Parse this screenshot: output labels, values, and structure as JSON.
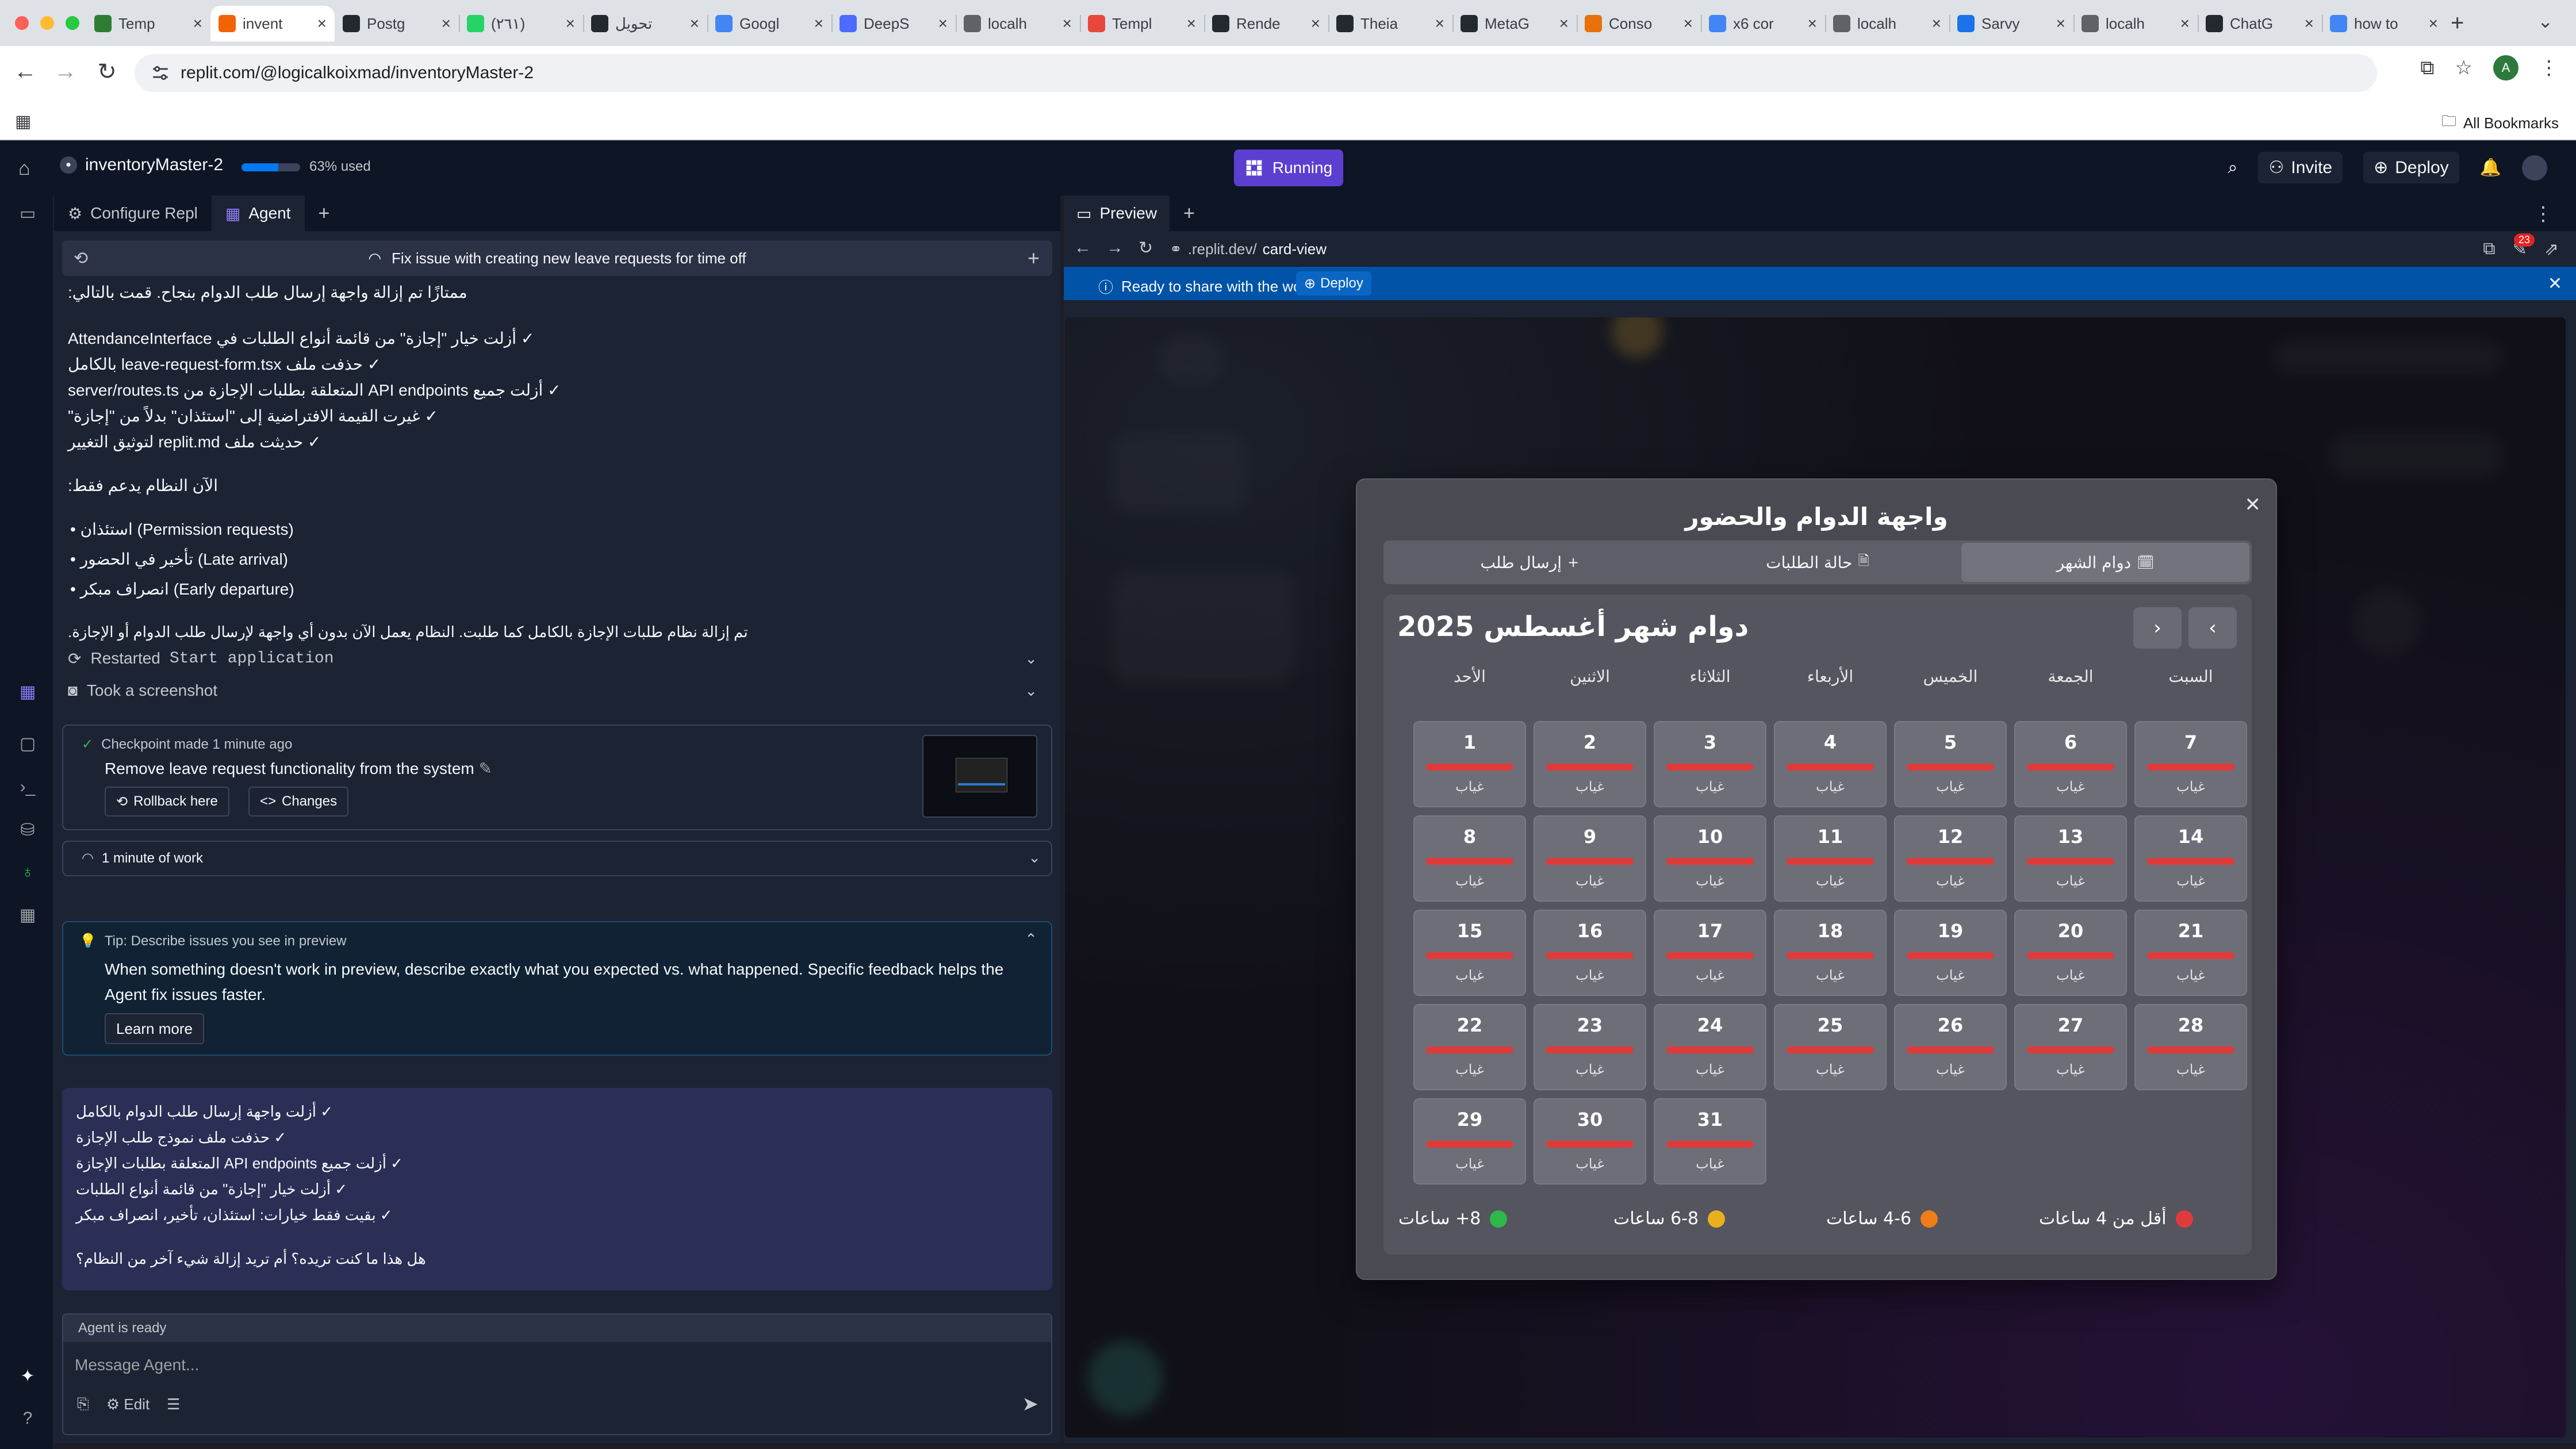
{
  "browser": {
    "tabs": [
      {
        "title": "Temp",
        "icon": "shield-icon",
        "color": "#2e7d32"
      },
      {
        "title": "invent",
        "icon": "replit-icon",
        "color": "#f26207",
        "active": true
      },
      {
        "title": "Postg",
        "icon": "github-icon",
        "color": "#24292f"
      },
      {
        "title": "(٢٦١)",
        "icon": "whatsapp-icon",
        "color": "#25d366"
      },
      {
        "title": "تحويل",
        "icon": "github-icon",
        "color": "#24292f"
      },
      {
        "title": "Googl",
        "icon": "gemini-icon",
        "color": "#4285f4"
      },
      {
        "title": "DeepS",
        "icon": "deepseek-icon",
        "color": "#4d6bfe"
      },
      {
        "title": "localh",
        "icon": "globe-icon",
        "color": "#5f6368"
      },
      {
        "title": "Templ",
        "icon": "bolt-icon",
        "color": "#e8483b"
      },
      {
        "title": "Rende",
        "icon": "render-icon",
        "color": "#24292f"
      },
      {
        "title": "Theia",
        "icon": "theia-icon",
        "color": "#24292f"
      },
      {
        "title": "MetaG",
        "icon": "github-icon",
        "color": "#24292f"
      },
      {
        "title": "Conso",
        "icon": "ring-icon",
        "color": "#e8710a"
      },
      {
        "title": "x6 cor",
        "icon": "google-icon",
        "color": "#4285f4"
      },
      {
        "title": "localh",
        "icon": "globe-icon",
        "color": "#5f6368"
      },
      {
        "title": "Sarvy",
        "icon": "doc-icon",
        "color": "#1a73e8"
      },
      {
        "title": "localh",
        "icon": "globe-icon",
        "color": "#5f6368"
      },
      {
        "title": "ChatG",
        "icon": "chatgpt-icon",
        "color": "#24292f"
      },
      {
        "title": "how to",
        "icon": "google-icon",
        "color": "#4285f4"
      }
    ],
    "url": "replit.com/@logicalkoixmad/inventoryMaster-2",
    "bookmarks_label": "All Bookmarks",
    "profile_initial": "A"
  },
  "replit": {
    "project_name": "inventoryMaster-2",
    "usage_label": "63% used",
    "usage_fraction": 0.63,
    "run_label": "Running",
    "invite_label": "Invite",
    "deploy_label": "Deploy"
  },
  "agent": {
    "tabs": {
      "configure": "Configure Repl",
      "agent": "Agent"
    },
    "thread_title": "Fix issue with creating new leave requests for time off",
    "intro": "ممتازًا تم إزالة واجهة إرسال طلب الدوام بنجاح. قمت بالتالي:",
    "changes": [
      "✓ أزلت خيار \"إجازة\" من قائمة أنواع الطلبات في AttendanceInterface",
      "✓ حذفت ملف leave-request-form.tsx بالكامل",
      "✓ أزلت جميع API endpoints المتعلقة بطلبات الإجازة من server/routes.ts",
      "✓ غيرت القيمة الافتراضية إلى \"استئذان\" بدلاً من \"إجازة\"",
      "✓ حديثت ملف replit.md لتوثيق التغيير"
    ],
    "support_heading": "الآن النظام يدعم فقط:",
    "support_items": [
      "استئذان (Permission requests)",
      "تأخير في الحضور (Late arrival)",
      "انصراف مبكر (Early departure)"
    ],
    "summary": "تم إزالة نظام طلبات الإجازة بالكامل كما طلبت. النظام يعمل الآن بدون أي واجهة لإرسال طلب الدوام أو الإجازة.",
    "restarted_prefix": "Restarted",
    "restarted_code": "Start application",
    "screenshot_label": "Took a screenshot",
    "checkpoint": {
      "title": "Checkpoint made 1 minute ago",
      "description": "Remove leave request functionality from the system",
      "rollback": "Rollback here",
      "changes": "Changes"
    },
    "work_label": "1 minute of work",
    "tip": {
      "title": "Tip: Describe issues you see in preview",
      "body": "When something doesn't work in preview, describe exactly what you expected vs. what happened. Specific feedback helps the Agent fix issues faster.",
      "button": "Learn more"
    },
    "user_msg_lines": [
      "✓ أزلت واجهة إرسال طلب الدوام بالكامل",
      "✓ حذفت ملف نموذج طلب الإجازة",
      "✓ أزلت جميع API endpoints المتعلقة بطلبات الإجازة",
      "✓ أزلت خيار \"إجازة\" من قائمة أنواع الطلبات",
      "✓ بقيت فقط خيارات: استئذان، تأخير، انصراف مبكر"
    ],
    "user_msg_question": "هل هذا ما كنت تريده؟ أم تريد إزالة شيء آخر من النظام؟",
    "status": "Agent is ready",
    "input_placeholder": "Message Agent...",
    "edit_label": "Edit"
  },
  "preview": {
    "tab_label": "Preview",
    "url_prefix": ".replit.dev/",
    "url_path": "card-view",
    "badge": "23",
    "banner_text": "Ready to share with the world?",
    "banner_button": "Deploy"
  },
  "modal": {
    "title": "واجهة الدوام والحضور",
    "tabs": [
      {
        "label": "دوام الشهر",
        "active": true
      },
      {
        "label": "حالة الطلبات",
        "active": false
      },
      {
        "label": "إرسال طلب",
        "active": false
      }
    ],
    "calendar_title": "دوام شهر أغسطس 2025",
    "weekdays": [
      "السبت",
      "الجمعة",
      "الخميس",
      "الأربعاء",
      "الثلاثاء",
      "الاثنين",
      "الأحد"
    ],
    "days": [
      1,
      2,
      3,
      4,
      5,
      6,
      7,
      8,
      9,
      10,
      11,
      12,
      13,
      14,
      15,
      16,
      17,
      18,
      19,
      20,
      21,
      22,
      23,
      24,
      25,
      26,
      27,
      28,
      29,
      30,
      31
    ],
    "day_status": "غياب",
    "legend": [
      {
        "label": "أقل من 4 ساعات",
        "color": "#e03b3b"
      },
      {
        "label": "4-6 ساعات",
        "color": "#f07d1a"
      },
      {
        "label": "6-8 ساعات",
        "color": "#e8b020"
      },
      {
        "label": "8+ ساعات",
        "color": "#2eb84a"
      }
    ]
  },
  "colors": {
    "replit_bg": "#0e1525",
    "panel_bg": "#1c2333",
    "run_accent": "#5b3fd1",
    "banner_blue": "#0053a6",
    "absence_red": "#e03b3b"
  }
}
